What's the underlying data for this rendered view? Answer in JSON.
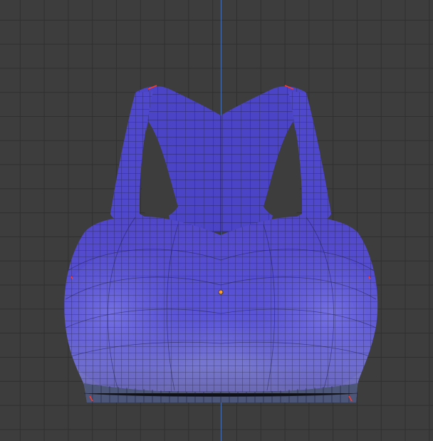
{
  "viewport": {
    "name": "3d-viewport",
    "view": "front-orthographic",
    "background": "#3d3d3d",
    "grid_color": "#2f2f2f",
    "axis_color": "#4a73b8"
  },
  "object": {
    "name": "sports-bra-mesh",
    "fill": "#5a52d6",
    "wire": "#15152b",
    "band": "#4c5678",
    "origin_marker": "#ff9b2a",
    "vertex_marker": "#ff3a2a"
  }
}
